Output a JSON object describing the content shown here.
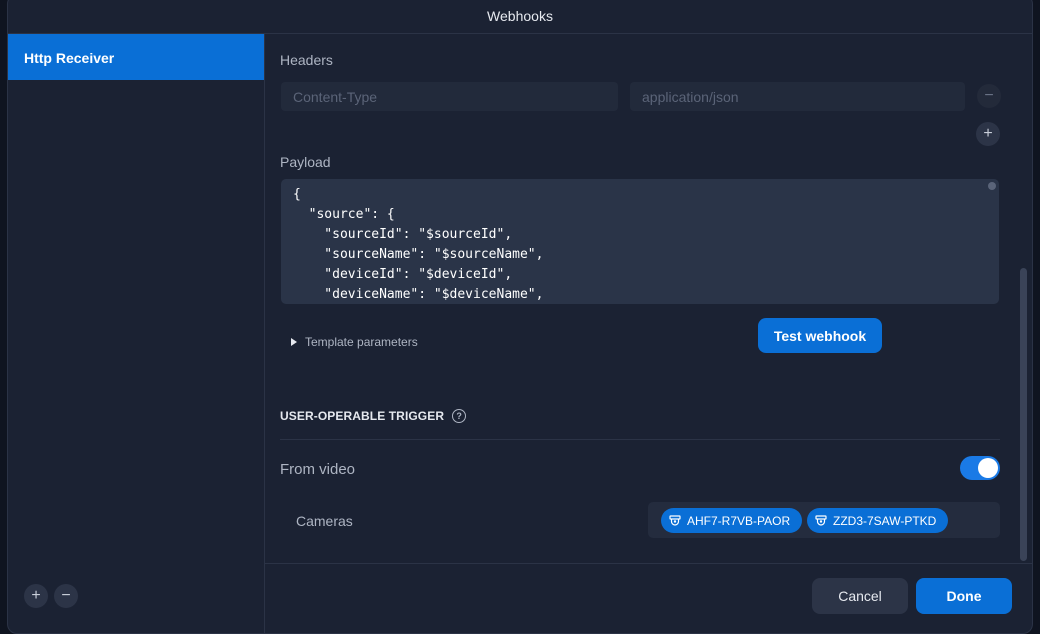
{
  "window": {
    "title": "Webhooks"
  },
  "sidebar": {
    "items": [
      {
        "label": "Http Receiver",
        "active": true
      }
    ],
    "add_icon": "plus-icon",
    "remove_icon": "minus-icon"
  },
  "headers": {
    "label": "Headers",
    "rows": [
      {
        "key_placeholder": "Content-Type",
        "value_placeholder": "application/json"
      }
    ]
  },
  "payload": {
    "label": "Payload",
    "content": "{\n  \"source\": {\n    \"sourceId\": \"$sourceId\",\n    \"sourceName\": \"$sourceName\",\n    \"deviceId\": \"$deviceId\",\n    \"deviceName\": \"$deviceName\","
  },
  "template_parameters": {
    "label": "Template parameters"
  },
  "test_button": {
    "label": "Test webhook"
  },
  "trigger": {
    "title": "USER-OPERABLE TRIGGER",
    "help_icon": "question-icon",
    "from_video": {
      "label": "From video",
      "enabled": true
    },
    "cameras": {
      "label": "Cameras",
      "items": [
        "AHF7-R7VB-PAOR",
        "ZZD3-7SAW-PTKD"
      ],
      "icon": "camera-icon"
    }
  },
  "footer": {
    "cancel_label": "Cancel",
    "done_label": "Done"
  },
  "colors": {
    "accent": "#0a6fd6",
    "panel": "#1b2233",
    "background": "#0f1420"
  }
}
